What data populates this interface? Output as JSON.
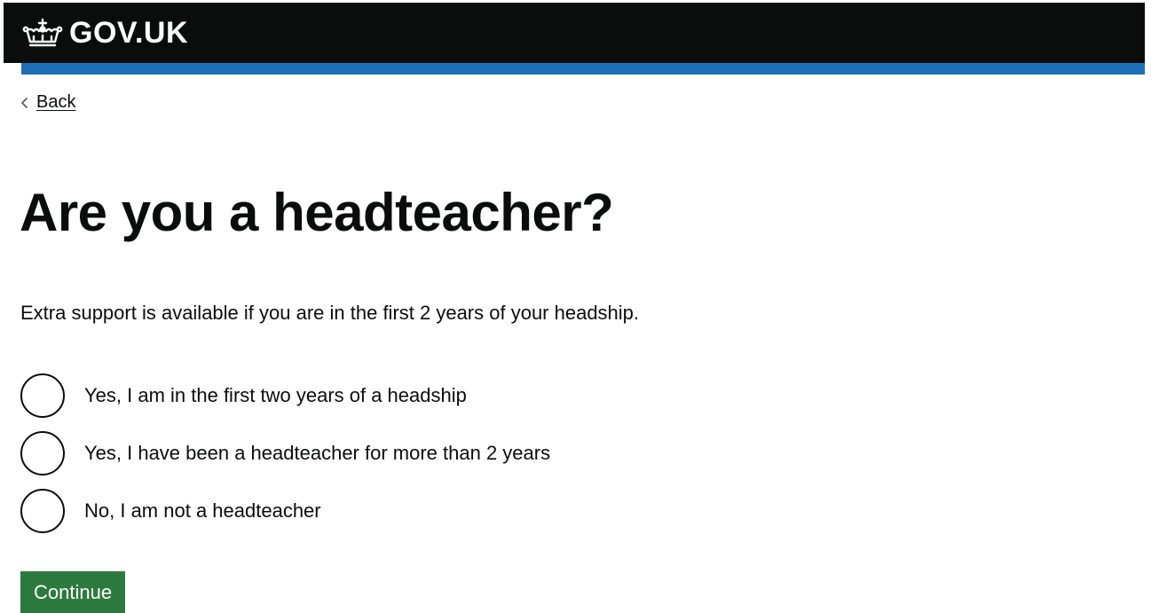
{
  "header": {
    "logo_icon": "crown-icon",
    "logo_text": "GOV.UK",
    "colors": {
      "background": "#0b0c0c",
      "accent_stripe": "#1d70b8"
    }
  },
  "nav": {
    "back_icon": "chevron-left-icon",
    "back_label": "Back"
  },
  "main": {
    "title": "Are you a headteacher?",
    "hint": "Extra support is available if you are in the first 2 years of your headship.",
    "options": [
      {
        "label": "Yes, I am in the first two years of a headship",
        "selected": false
      },
      {
        "label": "Yes, I have been a headteacher for more than 2 years",
        "selected": false
      },
      {
        "label": "No, I am not a headteacher",
        "selected": false
      }
    ],
    "continue_label": "Continue",
    "continue_color": "#2d7a3f"
  }
}
